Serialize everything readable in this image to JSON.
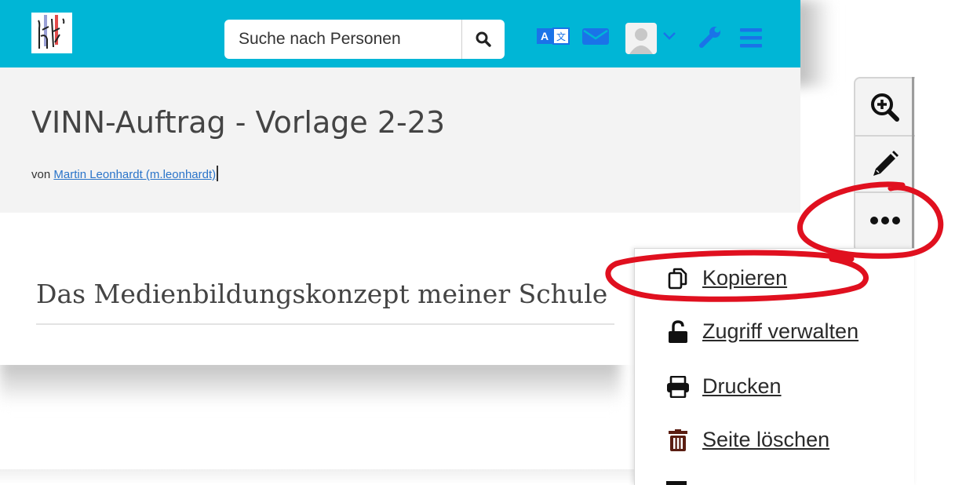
{
  "header": {
    "search_placeholder": "Suche nach Personen"
  },
  "page": {
    "title": "VINN-Auftrag - Vorlage 2-23",
    "by_prefix": "von",
    "author": "Martin Leonhardt (m.leonhardt)"
  },
  "content": {
    "section_title": "Das Medienbildungskonzept meiner Schule"
  },
  "toolbar": {
    "icons": [
      "zoom-in-icon",
      "pencil-icon",
      "ellipsis-icon"
    ]
  },
  "menu": {
    "items": [
      {
        "label": "Kopieren",
        "icon": "copy-icon"
      },
      {
        "label": "Zugriff verwalten",
        "icon": "unlock-icon"
      },
      {
        "label": "Drucken",
        "icon": "print-icon"
      },
      {
        "label": "Seite löschen",
        "icon": "trash-icon"
      }
    ]
  },
  "colors": {
    "topbar": "#00b6d6",
    "icon_blue": "#1a73e8",
    "link": "#2a74c9",
    "annotation_red": "#e0101f",
    "trash": "#5b1e12"
  }
}
